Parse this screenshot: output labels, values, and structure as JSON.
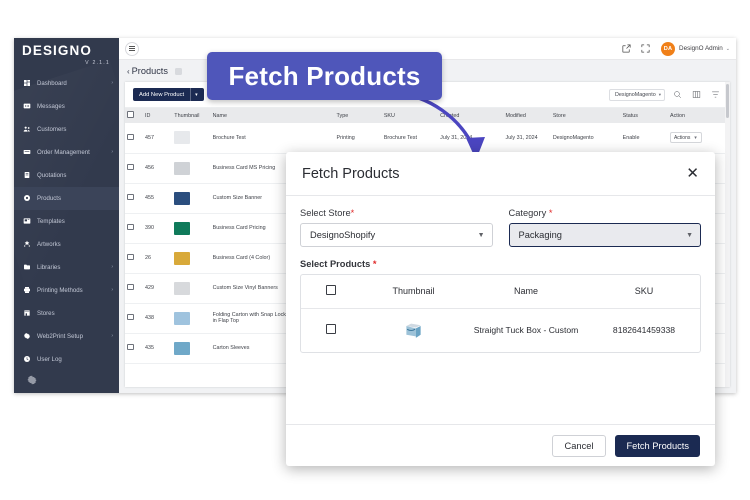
{
  "brand": {
    "name": "DESIGNO",
    "version": "V 2.1.1"
  },
  "sidebar": {
    "items": [
      {
        "label": "Dashboard",
        "icon": "dashboard-icon",
        "caret": "›",
        "active": false
      },
      {
        "label": "Messages",
        "icon": "messages-icon",
        "caret": "",
        "active": false
      },
      {
        "label": "Customers",
        "icon": "customers-icon",
        "caret": "",
        "active": false
      },
      {
        "label": "Order Management",
        "icon": "orders-icon",
        "caret": "›",
        "active": false
      },
      {
        "label": "Quotations",
        "icon": "quotations-icon",
        "caret": "",
        "active": false
      },
      {
        "label": "Products",
        "icon": "products-icon",
        "caret": "",
        "active": true
      },
      {
        "label": "Templates",
        "icon": "templates-icon",
        "caret": "",
        "active": false
      },
      {
        "label": "Artworks",
        "icon": "artworks-icon",
        "caret": "",
        "active": false
      },
      {
        "label": "Libraries",
        "icon": "libraries-icon",
        "caret": "›",
        "active": false
      },
      {
        "label": "Printing Methods",
        "icon": "printing-methods-icon",
        "caret": "›",
        "active": false
      },
      {
        "label": "Stores",
        "icon": "stores-icon",
        "caret": "",
        "active": false
      },
      {
        "label": "Web2Print Setup",
        "icon": "web2print-setup-icon",
        "caret": "›",
        "active": false
      },
      {
        "label": "User Log",
        "icon": "user-log-icon",
        "caret": "",
        "active": false
      }
    ],
    "settings_icon": "gear-icon"
  },
  "topbar": {
    "menu_icon": "hamburger-icon",
    "external_icon": "external-link-icon",
    "fullscreen_icon": "fullscreen-icon",
    "avatar_initials": "DA",
    "admin_name": "DesignO Admin",
    "admin_caret": "⌄"
  },
  "breadcrumb": {
    "back": "‹",
    "title": "Products"
  },
  "toolbar": {
    "add_new_label": "Add New Product",
    "add_new_caret": "▾",
    "store_filter": "DesignoMagento",
    "store_caret": "▾",
    "search_icon": "search-icon",
    "columns_icon": "grid-columns-icon",
    "filter_icon": "filter-icon"
  },
  "grid": {
    "columns": [
      "",
      "ID",
      "Thumbnail",
      "Name",
      "Type",
      "SKU",
      "Created",
      "Modified",
      "Store",
      "Status",
      "Action"
    ],
    "rows": [
      {
        "id": "457",
        "name": "Brochure Test",
        "type": "Printing",
        "sku": "Brochure Test",
        "created": "July 31, 2024",
        "modified": "July 31, 2024",
        "store": "DesignoMagento",
        "status": "Enable",
        "action": "Actions",
        "thumb": "#e7e9ec"
      },
      {
        "id": "456",
        "name": "Business Card MS Pricing",
        "type": "",
        "sku": "",
        "created": "",
        "modified": "",
        "store": "",
        "status": "",
        "action": "",
        "thumb": "#cfd2d6"
      },
      {
        "id": "455",
        "name": "Custom Size Banner",
        "type": "",
        "sku": "",
        "created": "",
        "modified": "",
        "store": "",
        "status": "",
        "action": "",
        "thumb": "#2b4e7e"
      },
      {
        "id": "390",
        "name": "Business Card Pricing",
        "type": "",
        "sku": "",
        "created": "",
        "modified": "",
        "store": "",
        "status": "",
        "action": "",
        "thumb": "#0f7a5a"
      },
      {
        "id": "26",
        "name": "Business Card (4 Color)",
        "type": "",
        "sku": "",
        "created": "",
        "modified": "",
        "store": "",
        "status": "",
        "action": "",
        "thumb": "#d8a93a"
      },
      {
        "id": "429",
        "name": "Custom Size Vinyl Banners",
        "type": "",
        "sku": "",
        "created": "",
        "modified": "",
        "store": "",
        "status": "",
        "action": "",
        "thumb": "#d7d9dc"
      },
      {
        "id": "438",
        "name": "Folding Carton with Snap Lock Bottom and Tuck in Flap Top",
        "type": "",
        "sku": "",
        "created": "",
        "modified": "",
        "store": "",
        "status": "",
        "action": "",
        "thumb": "#9fc3de"
      },
      {
        "id": "435",
        "name": "Carton Sleeves",
        "type": "",
        "sku": "",
        "created": "",
        "modified": "",
        "store": "",
        "status": "",
        "action": "",
        "thumb": "#6fa8c8"
      }
    ]
  },
  "callout": {
    "text": "Fetch Products",
    "color": "#4f56ba",
    "arrow_color": "#4b45c0"
  },
  "modal": {
    "title": "Fetch Products",
    "close_icon": "close-icon",
    "store_label": "Select Store",
    "store_value": "DesignoShopify",
    "category_label": "Category",
    "category_value": "Packaging",
    "select_products_label": "Select Products",
    "required_mark": "*",
    "product_columns": [
      "",
      "Thumbnail",
      "Name",
      "SKU"
    ],
    "products": [
      {
        "name": "Straight Tuck Box - Custom",
        "sku": "8182641459338"
      }
    ],
    "cancel_label": "Cancel",
    "submit_label": "Fetch Products"
  }
}
